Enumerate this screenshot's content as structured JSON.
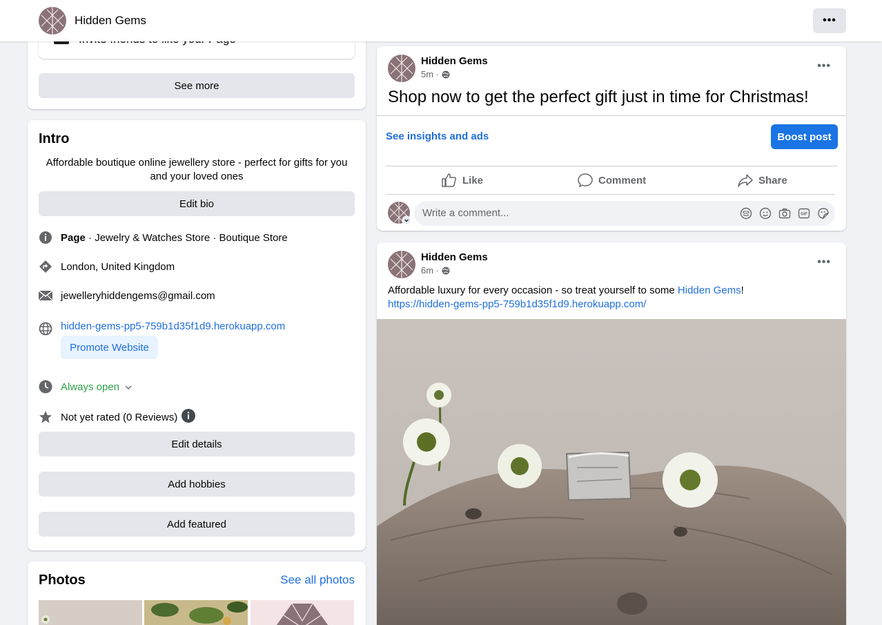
{
  "topbar": {
    "page_name": "Hidden Gems",
    "more_label": "•••"
  },
  "sidebar": {
    "invite_label": "Invite friends to like your Page",
    "see_more_label": "See more",
    "intro": {
      "title": "Intro",
      "bio": "Affordable boutique online jewellery store - perfect for gifts for you and your loved ones",
      "edit_bio_label": "Edit bio",
      "page_label": "Page",
      "categories": " · Jewelry & Watches Store · Boutique Store",
      "location": "London, United Kingdom",
      "email": "jewelleryhiddengems@gmail.com",
      "website": "hidden-gems-pp5-759b1d35f1d9.herokuapp.com",
      "promote_label": "Promote Website",
      "hours": "Always open",
      "rating": "Not yet rated (0 Reviews)",
      "edit_details_label": "Edit details",
      "add_hobbies_label": "Add hobbies",
      "add_featured_label": "Add featured"
    },
    "photos": {
      "title": "Photos",
      "see_all_label": "See all photos"
    }
  },
  "posts": [
    {
      "author": "Hidden Gems",
      "time": "5m ·",
      "text": "Shop now to get the perfect gift just in time for Christmas!",
      "insights_label": "See insights and ads",
      "boost_label": "Boost post",
      "like_label": "Like",
      "comment_label": "Comment",
      "share_label": "Share",
      "comment_placeholder": "Write a comment..."
    },
    {
      "author": "Hidden Gems",
      "time": "6m ·",
      "text_before": "Affordable luxury for every occasion - so treat yourself to some ",
      "text_link": "Hidden Gems",
      "text_after": "!",
      "url": "https://hidden-gems-pp5-759b1d35f1d9.herokuapp.com/"
    }
  ],
  "colors": {
    "accent": "#1b74e4",
    "link": "#216fdb",
    "green": "#31a24c",
    "avatar": "#8a7376"
  }
}
